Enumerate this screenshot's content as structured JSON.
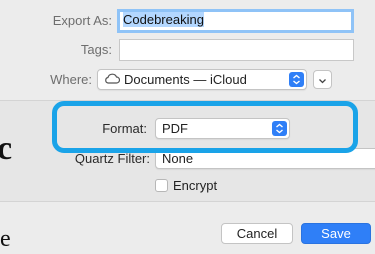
{
  "dialog": {
    "export_as": {
      "label": "Export As:",
      "value": "Codebreaking"
    },
    "tags": {
      "label": "Tags:",
      "value": ""
    },
    "where": {
      "label": "Where:",
      "value": "Documents — iCloud"
    },
    "format": {
      "label": "Format:",
      "value": "PDF"
    },
    "quartz_filter": {
      "label": "Quartz Filter:",
      "value": "None"
    },
    "encrypt": {
      "label": "Encrypt",
      "checked": false
    },
    "buttons": {
      "cancel": "Cancel",
      "save": "Save"
    }
  },
  "background_fragments": [
    "c",
    "e"
  ],
  "colors": {
    "accent": "#2f7ff7",
    "highlight_ring": "#1aa3e8",
    "selection": "#b3d7ff"
  },
  "icons": {
    "location": "cloud-icon",
    "popup_arrows": "chevron-up-down-icon",
    "expand": "chevron-down-icon"
  }
}
